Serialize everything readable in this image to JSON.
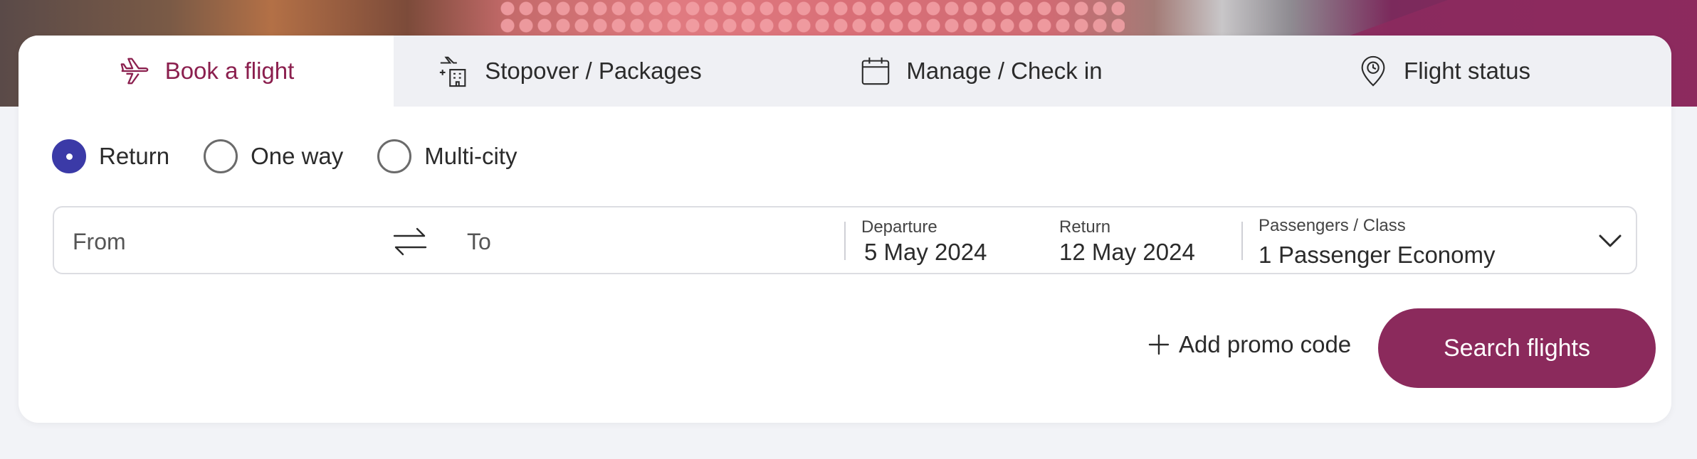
{
  "tabs": [
    {
      "label": "Book a flight",
      "icon": "plane-icon"
    },
    {
      "label": "Stopover / Packages",
      "icon": "plane-hotel-icon"
    },
    {
      "label": "Manage / Check in",
      "icon": "calendar-icon"
    },
    {
      "label": "Flight status",
      "icon": "location-clock-icon"
    }
  ],
  "trip_types": [
    {
      "label": "Return",
      "selected": true
    },
    {
      "label": "One way",
      "selected": false
    },
    {
      "label": "Multi-city",
      "selected": false
    }
  ],
  "search": {
    "from_placeholder": "From",
    "to_placeholder": "To",
    "departure_label": "Departure",
    "departure_value": "5 May 2024",
    "return_label": "Return",
    "return_value": "12 May 2024",
    "passengers_label": "Passengers / Class",
    "passengers_count": "1",
    "passengers_class": "Passenger Economy"
  },
  "actions": {
    "promo_label": "Add promo code",
    "search_label": "Search flights"
  },
  "colors": {
    "accent": "#8b2a5c",
    "radio_selected": "#3b3aa7"
  }
}
